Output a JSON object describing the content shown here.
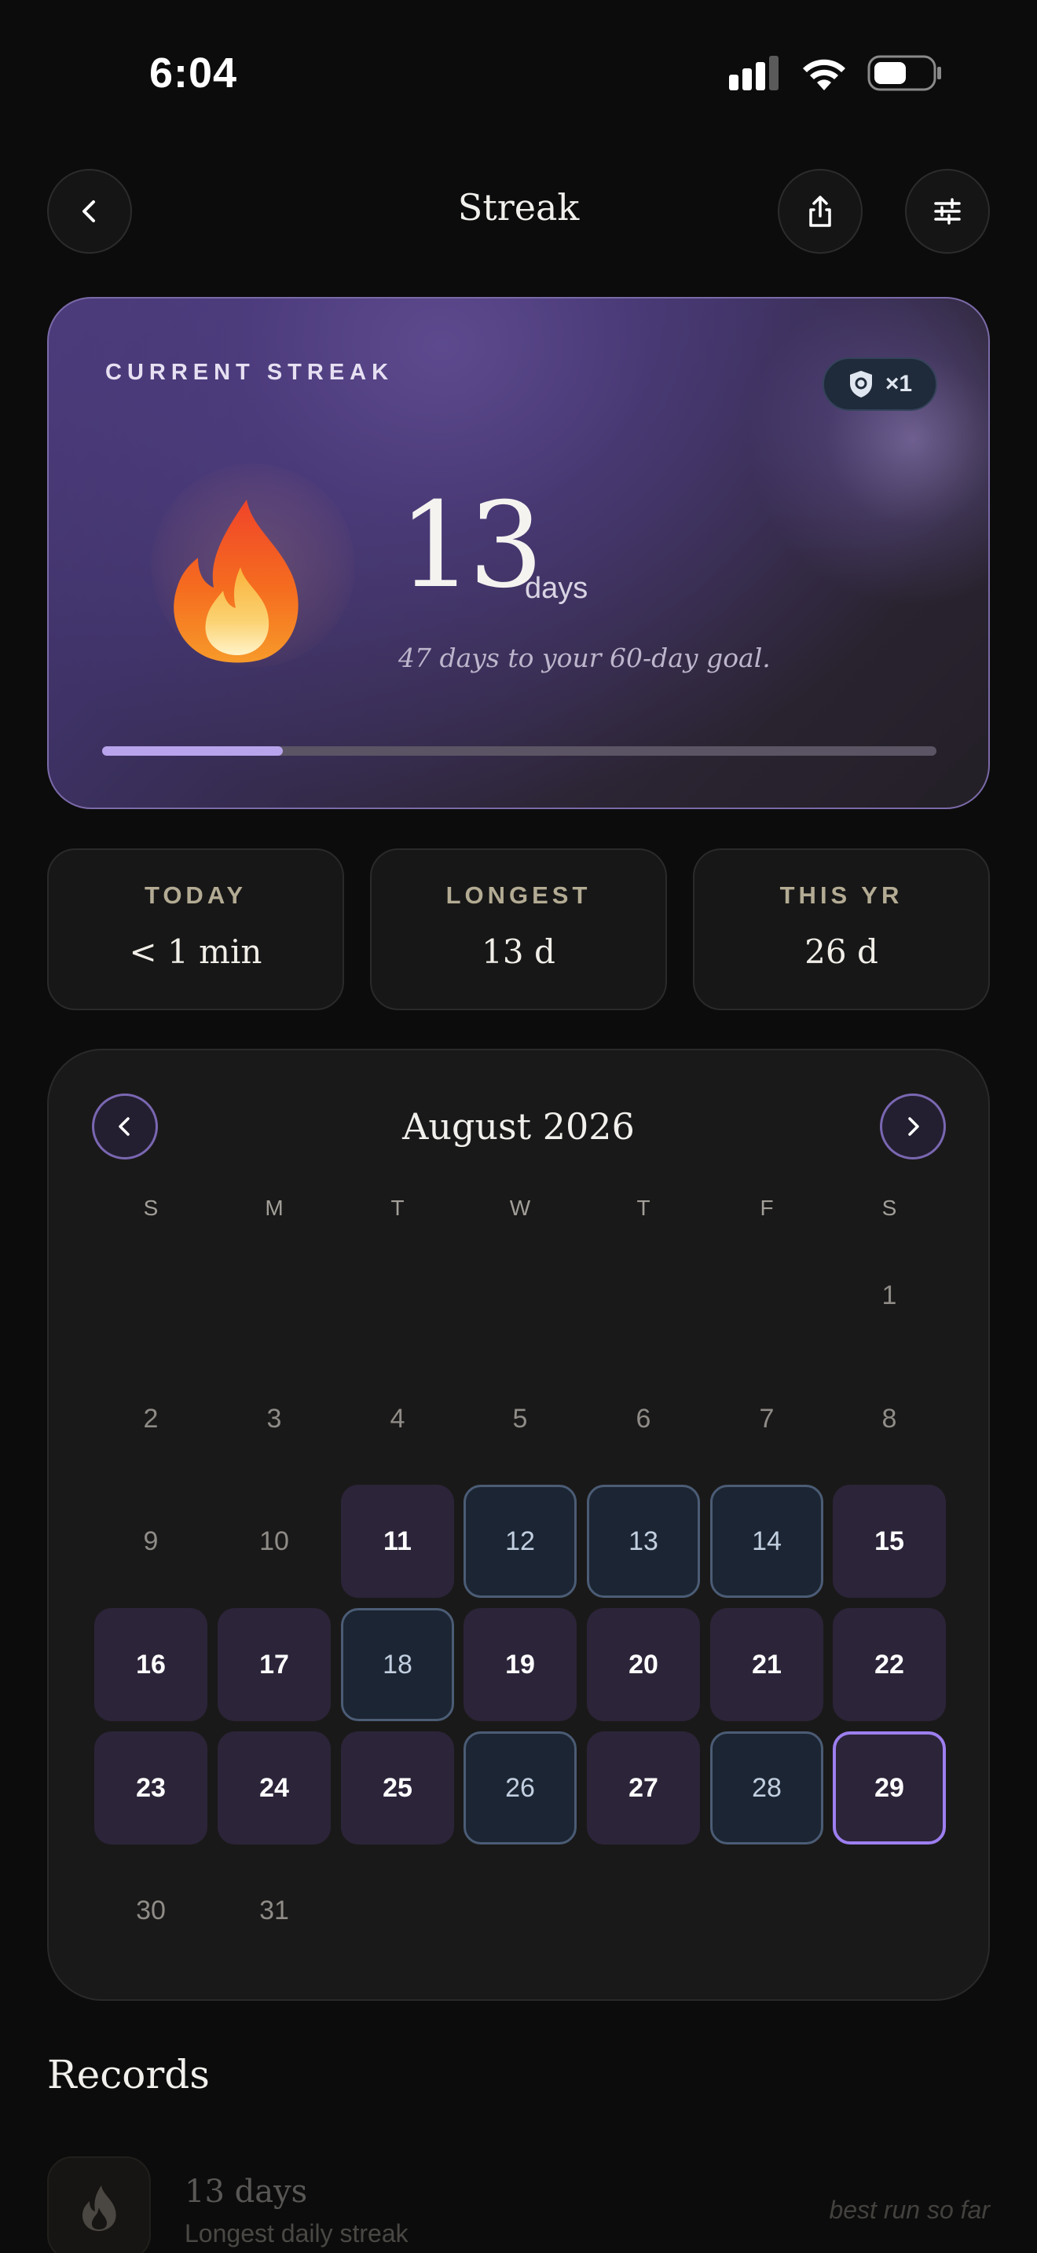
{
  "status_bar": {
    "time": "6:04"
  },
  "header": {
    "title": "Streak"
  },
  "streak_card": {
    "label": "CURRENT STREAK",
    "shield_count": "×1",
    "number": "13",
    "unit": "days",
    "subtitle": "47 days to your 60-day goal.",
    "progress": 0.2167
  },
  "stats": [
    {
      "label": "TODAY",
      "value": "< 1 min"
    },
    {
      "label": "LONGEST",
      "value": "13 d"
    },
    {
      "label": "THIS YR",
      "value": "26 d"
    }
  ],
  "calendar": {
    "month_label": "August 2026",
    "weekdays": [
      "S",
      "M",
      "T",
      "W",
      "T",
      "F",
      "S"
    ],
    "days": [
      "1",
      "2",
      "3",
      "4",
      "5",
      "6",
      "7",
      "8",
      "9",
      "10",
      "11",
      "12",
      "13",
      "14",
      "15",
      "16",
      "17",
      "18",
      "19",
      "20",
      "21",
      "22",
      "23",
      "24",
      "25",
      "26",
      "27",
      "28",
      "29",
      "30",
      "31"
    ],
    "active_days": [
      11,
      15,
      16,
      17,
      19,
      20,
      21,
      22,
      23,
      24,
      25,
      27
    ],
    "freeze_days": [
      12,
      13,
      14,
      18,
      26,
      28
    ],
    "today": 29
  },
  "records": {
    "title": "Records",
    "items": [
      {
        "value": "13 days",
        "description": "Longest daily streak",
        "note": "best run so far"
      }
    ]
  },
  "colors": {
    "accent": "#9d7ff0",
    "active_day": "#2c2439",
    "freeze_day": "#1c2533",
    "background": "#0c0c0c"
  }
}
